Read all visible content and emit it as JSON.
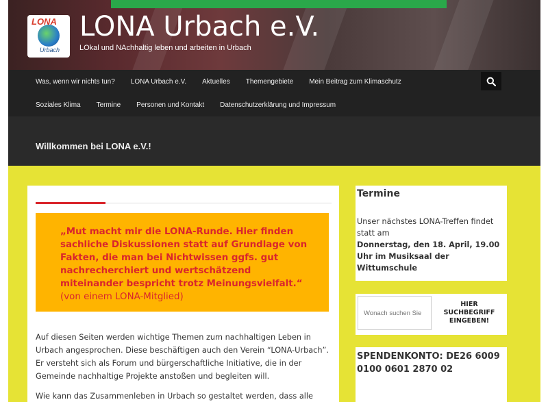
{
  "header": {
    "logo_top": "LONA",
    "logo_bottom": "Urbach",
    "title": "LONA Urbach e.V.",
    "description": "LOkal und NAchhaltig leben und arbeiten in Urbach"
  },
  "nav": {
    "row1": [
      "Was, wenn wir nichts tun?",
      "LONA Urbach e.V.",
      "Aktuelles",
      "Themengebiete",
      "Mein Beitrag zum Klimaschutz"
    ],
    "row2": [
      "Soziales Klima",
      "Termine",
      "Personen und Kontakt",
      "Datenschutzerklärung und Impressum"
    ],
    "search_icon": "search-icon"
  },
  "page": {
    "heading": "Willkommen bei LONA e.V.!"
  },
  "main": {
    "quote_bold": "„Mut macht mir die LONA-Runde. Hier finden sachliche Diskussionen statt auf Grundlage von Fakten, die man bei Nichtwissen ggfs. gut nachrecherchiert und wertschätzend miteinander bespricht trotz Meinungsvielfalt.“",
    "quote_attribution": " (von einem LONA-Mitglied)",
    "paragraph1": "Auf diesen Seiten werden wichtige Themen zum nachhaltigen Leben in Urbach angesprochen. Diese beschäftigen auch den Verein “LONA-Urbach”. Er versteht sich als Forum und bürgerschaftliche Initiative, die in der Gemeinde nachhaltige Projekte anstoßen und begleiten will.",
    "paragraph2": "Wie kann das Zusammenleben in Urbach so gestaltet werden, dass alle"
  },
  "sidebar": {
    "termine": {
      "title": "Termine",
      "text": "Unser nächstes LONA-Treffen findet statt am",
      "date_bold": "Donnerstag, den 18. April, 19.00 Uhr im Musiksaal der Wittumschule"
    },
    "search": {
      "placeholder": "Wonach suchen Sie",
      "button": "HIER SUCHBEGRIFF EINGEBEN!"
    },
    "spenden": {
      "title": "SPENDENKONTO: DE26 6009 0100 0601 2870 02"
    }
  },
  "colors": {
    "page_background": "#e6e335",
    "quote_background": "#ffb400",
    "quote_text": "#d9262c",
    "nav_background": "#222222"
  }
}
